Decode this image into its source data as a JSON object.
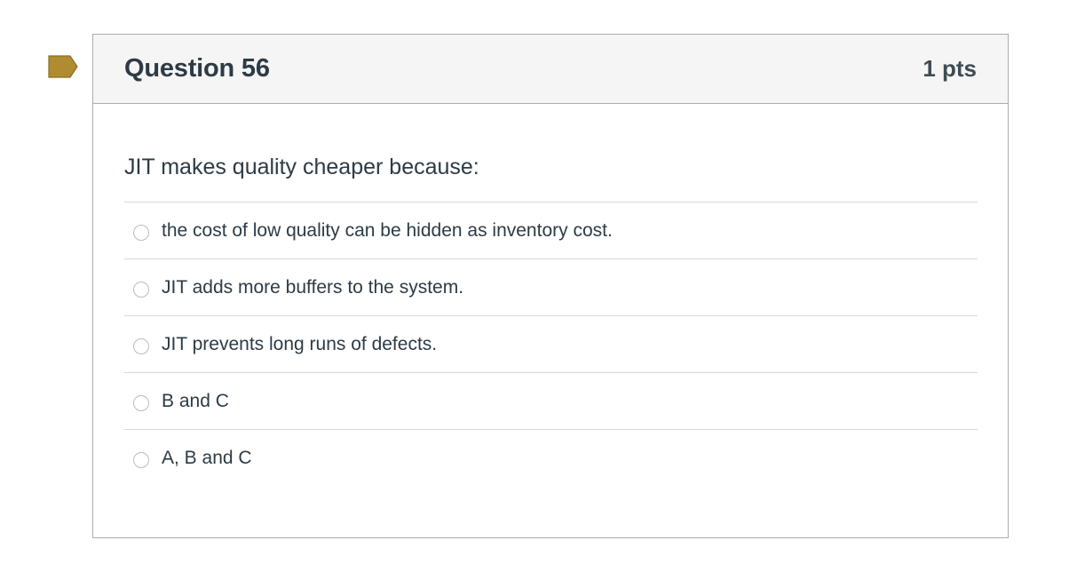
{
  "question": {
    "title": "Question 56",
    "points": "1 pts",
    "text": "JIT makes quality cheaper because:",
    "answers": [
      {
        "label": "the cost of low quality can be hidden as inventory cost."
      },
      {
        "label": "JIT adds more buffers to the system."
      },
      {
        "label": "JIT prevents long runs of defects."
      },
      {
        "label": "B and C"
      },
      {
        "label": "A, B and C"
      }
    ]
  },
  "colors": {
    "flag": "#b08c31",
    "border": "#a9adb1",
    "header_bg": "#f5f5f5",
    "text": "#2d3b45"
  },
  "icons": {
    "flag": "bookmark-flag-icon",
    "radio": "radio-unchecked-icon"
  }
}
